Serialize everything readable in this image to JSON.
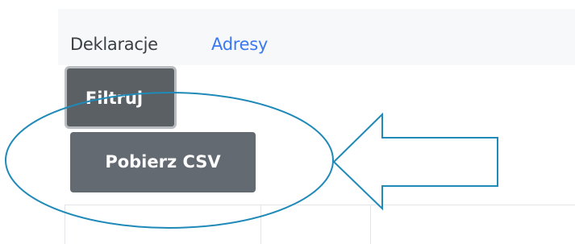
{
  "tabs": {
    "declarations_label": "Deklaracje",
    "addresses_label": "Adresy"
  },
  "buttons": {
    "filter_label": "Filtruj",
    "download_csv_label": "Pobierz CSV"
  },
  "colors": {
    "link_blue": "#3a78f2",
    "annotation_teal": "#1f8ab8",
    "button_dark_gray": "#5b6065"
  },
  "annotation": {
    "shapes": [
      "ellipse",
      "left-arrow"
    ]
  }
}
